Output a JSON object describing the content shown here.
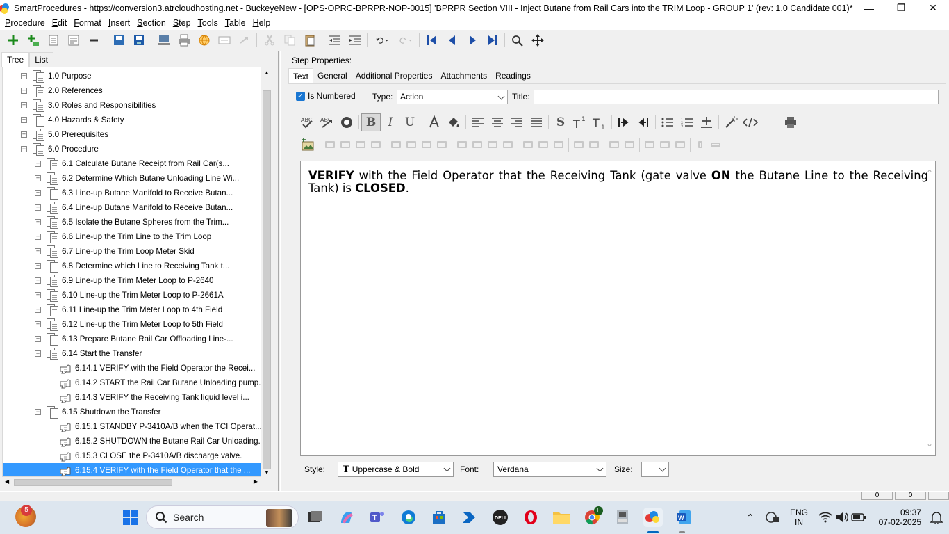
{
  "window": {
    "title": "SmartProcedures - https://conversion3.atrcloudhosting.net - BuckeyeNew - [OPS-OPRC-BPRPR-NOP-0015] 'BPRPR Section VIII - Inject Butane from Rail Cars into the TRIM Loop - GROUP 1' (rev: 1.0 Candidate 001)*",
    "min_icon": "minimize-icon",
    "max_icon": "restore-icon",
    "close_icon": "close-icon"
  },
  "menu": [
    "Procedure",
    "Edit",
    "Format",
    "Insert",
    "Section",
    "Step",
    "Tools",
    "Table",
    "Help"
  ],
  "left_tabs": [
    "Tree",
    "List"
  ],
  "tree": [
    {
      "level": 0,
      "icon": "doc",
      "exp": "+",
      "text": "1.0 Purpose"
    },
    {
      "level": 0,
      "icon": "doc",
      "exp": "+",
      "text": "2.0 References"
    },
    {
      "level": 0,
      "icon": "doc",
      "exp": "+",
      "text": "3.0 Roles and Responsibilities"
    },
    {
      "level": 0,
      "icon": "doc",
      "exp": "+",
      "text": "4.0 Hazards & Safety"
    },
    {
      "level": 0,
      "icon": "doc",
      "exp": "+",
      "text": "5.0 Prerequisites"
    },
    {
      "level": 0,
      "icon": "doc",
      "exp": "−",
      "text": "6.0 Procedure"
    },
    {
      "level": 1,
      "icon": "doc",
      "exp": "+",
      "text": "6.1 Calculate Butane Receipt from Rail Car(s..."
    },
    {
      "level": 1,
      "icon": "doc",
      "exp": "+",
      "text": "6.2 Determine Which Butane Unloading Line Wi..."
    },
    {
      "level": 1,
      "icon": "doc",
      "exp": "+",
      "text": "6.3 Line-up Butane Manifold to Receive Butan..."
    },
    {
      "level": 1,
      "icon": "doc",
      "exp": "+",
      "text": "6.4 Line-up Butane Manifold to Receive Butan..."
    },
    {
      "level": 1,
      "icon": "doc",
      "exp": "+",
      "text": "6.5 Isolate the Butane Spheres from the Trim..."
    },
    {
      "level": 1,
      "icon": "doc",
      "exp": "+",
      "text": "6.6 Line-up the Trim Line to the Trim Loop"
    },
    {
      "level": 1,
      "icon": "doc",
      "exp": "+",
      "text": "6.7 Line-up the Trim Loop Meter Skid"
    },
    {
      "level": 1,
      "icon": "doc",
      "exp": "+",
      "text": "6.8 Determine which Line to Receiving Tank t..."
    },
    {
      "level": 1,
      "icon": "doc",
      "exp": "+",
      "text": "6.9 Line-up the Trim Meter Loop to P-2640"
    },
    {
      "level": 1,
      "icon": "doc",
      "exp": "+",
      "text": "6.10 Line-up the Trim Meter Loop to P-2661A"
    },
    {
      "level": 1,
      "icon": "doc",
      "exp": "+",
      "text": "6.11 Line-up the Trim Meter Loop to 4th Field"
    },
    {
      "level": 1,
      "icon": "doc",
      "exp": "+",
      "text": "6.12 Line-up the Trim Meter Loop to 5th Field"
    },
    {
      "level": 1,
      "icon": "doc",
      "exp": "+",
      "text": "6.13 Prepare Butane Rail Car Offloading Line-..."
    },
    {
      "level": 1,
      "icon": "doc",
      "exp": "−",
      "text": "6.14 Start the Transfer"
    },
    {
      "level": 2,
      "icon": "hand",
      "exp": "",
      "text": "6.14.1 VERIFY with the Field Operator the Recei..."
    },
    {
      "level": 2,
      "icon": "hand",
      "exp": "",
      "text": "6.14.2 START the Rail Car Butane Unloading pump..."
    },
    {
      "level": 2,
      "icon": "hand",
      "exp": "",
      "text": "6.14.3 VERIFY the Receiving Tank liquid level i..."
    },
    {
      "level": 1,
      "icon": "doc",
      "exp": "−",
      "text": "6.15 Shutdown the Transfer"
    },
    {
      "level": 2,
      "icon": "hand",
      "exp": "",
      "text": "6.15.1 STANDBY P-3410A/B when the TCI Operat..."
    },
    {
      "level": 2,
      "icon": "hand",
      "exp": "",
      "text": "6.15.2 SHUTDOWN the Butane Rail Car Unloading..."
    },
    {
      "level": 2,
      "icon": "hand",
      "exp": "",
      "text": "6.15.3 CLOSE the P-3410A/B discharge valve."
    },
    {
      "level": 2,
      "icon": "hand",
      "exp": "",
      "text": "6.15.4 VERIFY with the Field Operator that the ...",
      "selected": true
    }
  ],
  "step_properties": {
    "label": "Step Properties:",
    "tabs": [
      "Text",
      "General",
      "Additional Properties",
      "Attachments",
      "Readings"
    ],
    "active_tab": "Text",
    "is_numbered_label": "Is Numbered",
    "is_numbered": true,
    "type_label": "Type:",
    "type_value": "Action",
    "title_label": "Title:",
    "title_value": ""
  },
  "editor": {
    "segments": [
      {
        "text": "VERIFY",
        "bold": true
      },
      {
        "text": " with the Field Operator that the Receiving Tank (gate valve ",
        "bold": false
      },
      {
        "text": "ON",
        "bold": true
      },
      {
        "text": " the Butane Line to the Receiving Tank) is ",
        "bold": false
      },
      {
        "text": "CLOSED",
        "bold": true
      },
      {
        "text": ".",
        "bold": false
      }
    ]
  },
  "format_bar": {
    "style_label": "Style:",
    "style_value": "Uppercase & Bold",
    "font_label": "Font:",
    "font_value": "Verdana",
    "size_label": "Size:",
    "size_value": ""
  },
  "status": {
    "box1": "0",
    "box2": "0"
  },
  "taskbar": {
    "search_label": "Search",
    "notification_count": "5",
    "chrome_badge": "L",
    "lang": "ENG",
    "region": "IN",
    "time": "09:37",
    "date": "07-02-2025"
  },
  "colors": {
    "selection": "#3399ff",
    "accent": "#1976d2"
  }
}
